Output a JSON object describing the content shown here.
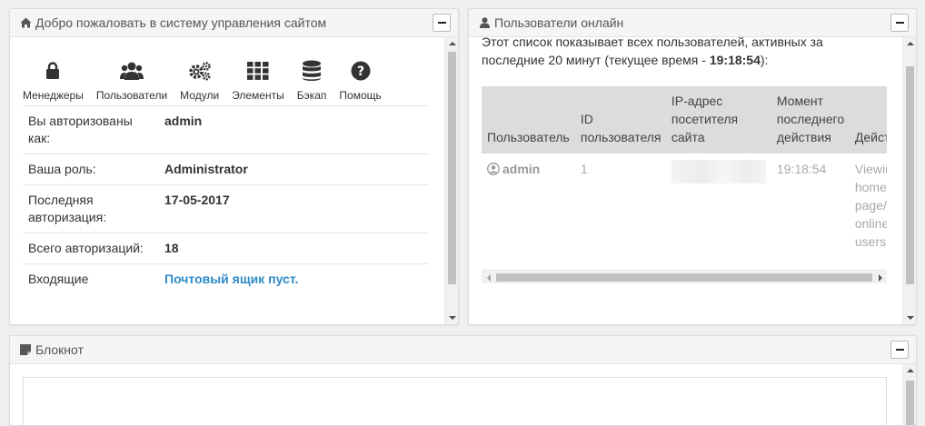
{
  "welcome": {
    "title": "Добро пожаловать в систему управления сайтом",
    "icons": [
      {
        "label": "Менеджеры",
        "icon": "lock-icon"
      },
      {
        "label": "Пользователи",
        "icon": "users-icon"
      },
      {
        "label": "Модули",
        "icon": "cogs-icon"
      },
      {
        "label": "Элементы",
        "icon": "grid-icon"
      },
      {
        "label": "Бэкап",
        "icon": "database-icon"
      },
      {
        "label": "Помощь",
        "icon": "help-icon"
      }
    ],
    "rows": [
      {
        "label": "Вы авторизованы как:",
        "value": "admin"
      },
      {
        "label": "Ваша роль:",
        "value": "Administrator"
      },
      {
        "label": "Последняя авторизация:",
        "value": "17-05-2017"
      },
      {
        "label": "Всего авторизаций:",
        "value": "18"
      },
      {
        "label": "Входящие",
        "value": "Почтовый ящик пуст."
      }
    ]
  },
  "online": {
    "title": "Пользователи онлайн",
    "intro_text": "Этот список показывает всех пользователей, активных за последние 20 минут (текущее время - ",
    "current_time": "19:18:54",
    "intro_end": "):",
    "columns": [
      "Пользователь",
      "ID пользователя",
      "IP-адрес посетителя сайта",
      "Момент последнего действия",
      "Действие"
    ],
    "rows": [
      {
        "user": "admin",
        "id": "1",
        "ip": "",
        "time": "19:18:54",
        "action": "Viewing home page/ online users"
      }
    ]
  },
  "notepad": {
    "title": "Блокнот"
  },
  "colors": {
    "link": "#2f8ac9",
    "header_bg": "#f5f5f5",
    "table_header_bg": "#dcdcdc"
  }
}
